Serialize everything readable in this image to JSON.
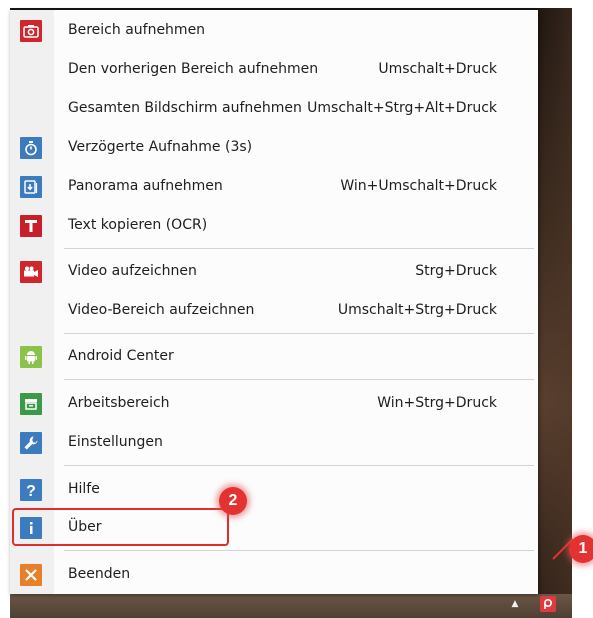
{
  "menu": {
    "items": [
      {
        "label": "Bereich aufnehmen",
        "shortcut": "",
        "icon": "camera-icon",
        "color": "#d0262d"
      },
      {
        "label": "Den vorherigen Bereich aufnehmen",
        "shortcut": "Umschalt+Druck",
        "icon": "",
        "color": ""
      },
      {
        "label": "Gesamten Bildschirm aufnehmen",
        "shortcut": "Umschalt+Strg+Alt+Druck",
        "icon": "",
        "color": ""
      },
      {
        "label": "Verzögerte Aufnahme (3s)",
        "shortcut": "",
        "icon": "stopwatch-icon",
        "color": "#3d7bbf"
      },
      {
        "label": "Panorama aufnehmen",
        "shortcut": "Win+Umschalt+Druck",
        "icon": "panorama-icon",
        "color": "#3d7bbf"
      },
      {
        "label": "Text kopieren (OCR)",
        "shortcut": "",
        "icon": "text-t-icon",
        "color": "#c8202a"
      },
      {
        "label": "Video aufzeichnen",
        "shortcut": "Strg+Druck",
        "icon": "video-camera-icon",
        "color": "#d0262d"
      },
      {
        "label": "Video-Bereich aufzeichnen",
        "shortcut": "Umschalt+Strg+Druck",
        "icon": "",
        "color": ""
      },
      {
        "label": "Android Center",
        "shortcut": "",
        "icon": "android-icon",
        "color": "#8bc34a"
      },
      {
        "label": "Arbeitsbereich",
        "shortcut": "Win+Strg+Druck",
        "icon": "workspace-icon",
        "color": "#3a9a4a"
      },
      {
        "label": "Einstellungen",
        "shortcut": "",
        "icon": "wrench-icon",
        "color": "#3d7bbf"
      },
      {
        "label": "Hilfe",
        "shortcut": "",
        "icon": "help-question-icon",
        "color": "#3d7bbf"
      },
      {
        "label": "Über",
        "shortcut": "",
        "icon": "info-icon",
        "color": "#3d7bbf"
      },
      {
        "label": "Beenden",
        "shortcut": "",
        "icon": "close-x-icon",
        "color": "#e8802a"
      }
    ]
  },
  "callouts": {
    "first": "1",
    "second": "2"
  },
  "tray": {
    "arrow_icon": "tray-up-arrow-icon",
    "app_icon": "picpick-tray-icon"
  }
}
